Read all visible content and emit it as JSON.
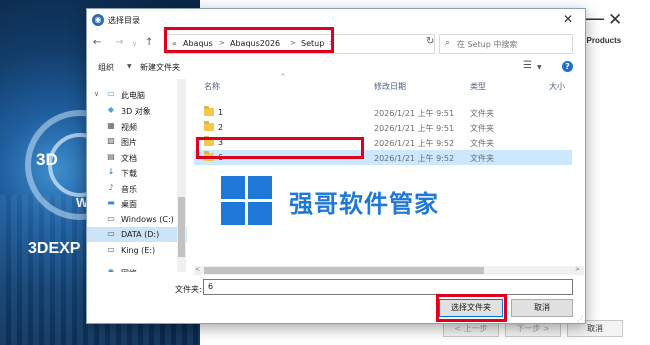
{
  "background": {
    "brand_text": "3DEXP",
    "logo_3d": "3D",
    "logo_w": "W",
    "products_text": "ed Products",
    "min_glyph": "—",
    "close_glyph": "✕",
    "buttons": {
      "prev": "< 上一步",
      "next": "下一步 >",
      "cancel": "取消"
    }
  },
  "dialog": {
    "title": "选择目录",
    "title_icon": "folder-picker-icon",
    "close_glyph": "✕",
    "nav": {
      "back": "←",
      "forward": "→",
      "dropdown": "∨",
      "up": "↑"
    },
    "address": {
      "prefix": "«",
      "crumbs": [
        "Abaqus",
        "Abaqus2026",
        "Setup"
      ],
      "separator": ">",
      "dropdown": "∨",
      "refresh": "↻"
    },
    "search": {
      "placeholder": "在 Setup 中搜索",
      "icon": "⌕"
    },
    "toolbar": {
      "organize": "组织",
      "organize_dd": "▼",
      "new_folder": "新建文件夹",
      "view": "☰",
      "view_dd": "▼",
      "help": "?"
    },
    "nav_pane": [
      {
        "label": "此电脑",
        "icon": "▭",
        "chevron": "∨",
        "color": "#4a90d9"
      },
      {
        "label": "3D 对象",
        "icon": "◆",
        "color": "#4aa5e0"
      },
      {
        "label": "视频",
        "icon": "▦",
        "color": "#555555"
      },
      {
        "label": "图片",
        "icon": "▨",
        "color": "#555555"
      },
      {
        "label": "文档",
        "icon": "▤",
        "color": "#555555"
      },
      {
        "label": "下载",
        "icon": "↓",
        "color": "#1e6fcc"
      },
      {
        "label": "音乐",
        "icon": "♪",
        "color": "#1e6fcc"
      },
      {
        "label": "桌面",
        "icon": "▬",
        "color": "#3a8ad8"
      },
      {
        "label": "Windows (C:)",
        "icon": "▭",
        "color": "#555555"
      },
      {
        "label": "DATA (D:)",
        "icon": "▭",
        "color": "#555555",
        "selected": true
      },
      {
        "label": "King (E:)",
        "icon": "▭",
        "color": "#555555"
      },
      {
        "label": "网络",
        "icon": "◉",
        "color": "#3a8ad8"
      }
    ],
    "columns": {
      "name": "名称",
      "date": "修改日期",
      "type": "类型",
      "size": "大小",
      "sort_glyph": "^"
    },
    "rows": [
      {
        "name": "1",
        "date": "2026/1/21 上午 9:51",
        "type": "文件夹"
      },
      {
        "name": "2",
        "date": "2026/1/21 上午 9:51",
        "type": "文件夹"
      },
      {
        "name": "3",
        "date": "2026/1/21 上午 9:52",
        "type": "文件夹"
      },
      {
        "name": "6",
        "date": "2026/1/21 上午 9:52",
        "type": "文件夹",
        "selected": true
      }
    ],
    "hscroll": {
      "left": "<",
      "right": ">"
    },
    "folder_label": "文件夹:",
    "folder_value": "6",
    "select_button": "选择文件夹",
    "cancel_button": "取消",
    "resize_grip": "⋰"
  },
  "watermark": {
    "text": "强哥软件管家",
    "color": "#1e78d8"
  },
  "highlight_color": "#e0001b"
}
